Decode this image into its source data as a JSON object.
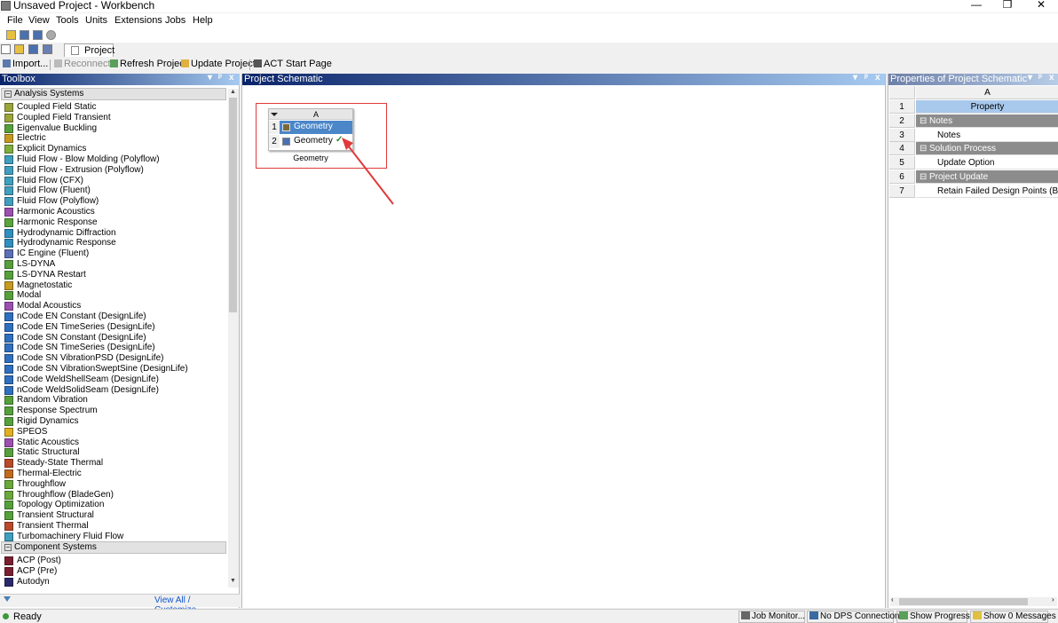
{
  "window": {
    "title": "Unsaved Project - Workbench",
    "minimize": "—",
    "restore": "❐",
    "close": "✕"
  },
  "menu": [
    "File",
    "View",
    "Tools",
    "Units",
    "Extensions",
    "Jobs",
    "Help"
  ],
  "tabs": {
    "project": "Project"
  },
  "toolbar": {
    "import": "Import...",
    "reconnect": "Reconnect",
    "refresh": "Refresh Project",
    "update": "Update Project",
    "act": "ACT Start Page"
  },
  "toolbox": {
    "title": "Toolbox",
    "controls": [
      "▾",
      "ᵖ",
      "x"
    ],
    "sections": {
      "analysis": "Analysis Systems",
      "component": "Component Systems"
    },
    "analysis_items": [
      {
        "label": "Coupled Field Static",
        "color": "#9aa53a"
      },
      {
        "label": "Coupled Field Transient",
        "color": "#9aa53a"
      },
      {
        "label": "Eigenvalue Buckling",
        "color": "#56a03c"
      },
      {
        "label": "Electric",
        "color": "#c69a20"
      },
      {
        "label": "Explicit Dynamics",
        "color": "#7fae3a"
      },
      {
        "label": "Fluid Flow - Blow Molding (Polyflow)",
        "color": "#3f9fbf"
      },
      {
        "label": "Fluid Flow - Extrusion (Polyflow)",
        "color": "#3f9fbf"
      },
      {
        "label": "Fluid Flow (CFX)",
        "color": "#3f9fbf"
      },
      {
        "label": "Fluid Flow (Fluent)",
        "color": "#3f9fbf"
      },
      {
        "label": "Fluid Flow (Polyflow)",
        "color": "#3f9fbf"
      },
      {
        "label": "Harmonic Acoustics",
        "color": "#9b4fb0"
      },
      {
        "label": "Harmonic Response",
        "color": "#5aa43c"
      },
      {
        "label": "Hydrodynamic Diffraction",
        "color": "#2f8fbf"
      },
      {
        "label": "Hydrodynamic Response",
        "color": "#2f8fbf"
      },
      {
        "label": "IC Engine (Fluent)",
        "color": "#5a6fb5"
      },
      {
        "label": "LS-DYNA",
        "color": "#56a03c"
      },
      {
        "label": "LS-DYNA Restart",
        "color": "#56a03c"
      },
      {
        "label": "Magnetostatic",
        "color": "#c69a20"
      },
      {
        "label": "Modal",
        "color": "#56a03c"
      },
      {
        "label": "Modal Acoustics",
        "color": "#9b4fb0"
      },
      {
        "label": "nCode EN Constant (DesignLife)",
        "color": "#2f6fbf"
      },
      {
        "label": "nCode EN TimeSeries (DesignLife)",
        "color": "#2f6fbf"
      },
      {
        "label": "nCode SN Constant (DesignLife)",
        "color": "#2f6fbf"
      },
      {
        "label": "nCode SN TimeSeries (DesignLife)",
        "color": "#2f6fbf"
      },
      {
        "label": "nCode SN VibrationPSD (DesignLife)",
        "color": "#2f6fbf"
      },
      {
        "label": "nCode SN VibrationSweptSine (DesignLife)",
        "color": "#2f6fbf"
      },
      {
        "label": "nCode WeldShellSeam (DesignLife)",
        "color": "#2f6fbf"
      },
      {
        "label": "nCode WeldSolidSeam (DesignLife)",
        "color": "#2f6fbf"
      },
      {
        "label": "Random Vibration",
        "color": "#56a03c"
      },
      {
        "label": "Response Spectrum",
        "color": "#56a03c"
      },
      {
        "label": "Rigid Dynamics",
        "color": "#56a03c"
      },
      {
        "label": "SPEOS",
        "color": "#e0b020"
      },
      {
        "label": "Static Acoustics",
        "color": "#9b4fb0"
      },
      {
        "label": "Static Structural",
        "color": "#56a03c"
      },
      {
        "label": "Steady-State Thermal",
        "color": "#b84a2a"
      },
      {
        "label": "Thermal-Electric",
        "color": "#c06a20"
      },
      {
        "label": "Throughflow",
        "color": "#6aa83a"
      },
      {
        "label": "Throughflow (BladeGen)",
        "color": "#6aa83a"
      },
      {
        "label": "Topology Optimization",
        "color": "#56a03c"
      },
      {
        "label": "Transient Structural",
        "color": "#56a03c"
      },
      {
        "label": "Transient Thermal",
        "color": "#b84a2a"
      },
      {
        "label": "Turbomachinery Fluid Flow",
        "color": "#3f9fbf"
      }
    ],
    "component_items": [
      {
        "label": "ACP (Post)",
        "color": "#7a1f2f"
      },
      {
        "label": "ACP (Pre)",
        "color": "#7a1f2f"
      },
      {
        "label": "Autodyn",
        "color": "#2a2a6a"
      }
    ],
    "footer_link": "View All / Customize..."
  },
  "schematic": {
    "title": "Project Schematic",
    "controls": [
      "▾",
      "ᵖ",
      "x"
    ],
    "system": {
      "column": "A",
      "rows": [
        {
          "num": "1",
          "label": "Geometry",
          "status": ""
        },
        {
          "num": "2",
          "label": "Geometry",
          "status": "✓"
        }
      ],
      "name": "Geometry"
    }
  },
  "properties": {
    "title": "Properties of Project Schematic",
    "controls": [
      "▾",
      "ᵖ",
      "x"
    ],
    "column": "A",
    "rows": [
      {
        "num": "1",
        "label": "Property",
        "kind": "hdr"
      },
      {
        "num": "2",
        "label": "Notes",
        "kind": "grp"
      },
      {
        "num": "3",
        "label": "Notes",
        "kind": "val"
      },
      {
        "num": "4",
        "label": "Solution Process",
        "kind": "grp"
      },
      {
        "num": "5",
        "label": "Update Option",
        "kind": "val"
      },
      {
        "num": "6",
        "label": "Project Update",
        "kind": "grp"
      },
      {
        "num": "7",
        "label": "Retain Failed Design Points (Beta)",
        "kind": "val"
      }
    ]
  },
  "status": {
    "ready": "Ready",
    "job_monitor": "Job Monitor...",
    "dps": "No DPS Connection",
    "progress": "Show Progress",
    "messages": "Show 0 Messages"
  },
  "colors": {
    "header_blue_start": "#0a246a",
    "header_blue_end": "#a6caf0",
    "selection": "#4a86c8",
    "red": "#e03a3a"
  }
}
